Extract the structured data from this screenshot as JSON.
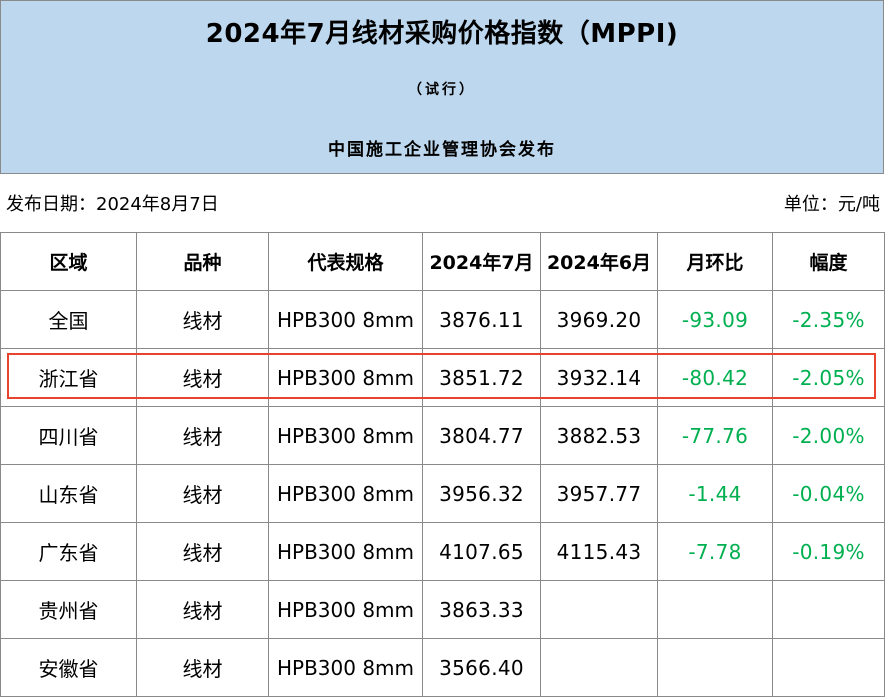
{
  "header": {
    "title": "2024年7月线材采购价格指数（MPPI)",
    "subtitle": "（试行）",
    "publisher": "中国施工企业管理协会发布"
  },
  "info": {
    "date_label": "发布日期：2024年8月7日",
    "unit_label": "单位：元/吨"
  },
  "table": {
    "columns": [
      "区域",
      "品种",
      "代表规格",
      "2024年7月",
      "2024年6月",
      "月环比",
      "幅度"
    ],
    "rows": [
      [
        "全国",
        "线材",
        "HPB300 8mm",
        "3876.11",
        "3969.20",
        "-93.09",
        "-2.35%"
      ],
      [
        "浙江省",
        "线材",
        "HPB300 8mm",
        "3851.72",
        "3932.14",
        "-80.42",
        "-2.05%"
      ],
      [
        "四川省",
        "线材",
        "HPB300 8mm",
        "3804.77",
        "3882.53",
        "-77.76",
        "-2.00%"
      ],
      [
        "山东省",
        "线材",
        "HPB300 8mm",
        "3956.32",
        "3957.77",
        "-1.44",
        "-0.04%"
      ],
      [
        "广东省",
        "线材",
        "HPB300 8mm",
        "4107.65",
        "4115.43",
        "-7.78",
        "-0.19%"
      ],
      [
        "贵州省",
        "线材",
        "HPB300 8mm",
        "3863.33",
        "",
        "",
        ""
      ],
      [
        "安徽省",
        "线材",
        "HPB300 8mm",
        "3566.40",
        "",
        "",
        ""
      ]
    ],
    "highlighted_row": "浙江省"
  },
  "colors": {
    "header_bg": "#bdd7ee",
    "negative_change": "#00b050",
    "highlight_border": "#e8432e",
    "grid": "#8a8a8a"
  }
}
